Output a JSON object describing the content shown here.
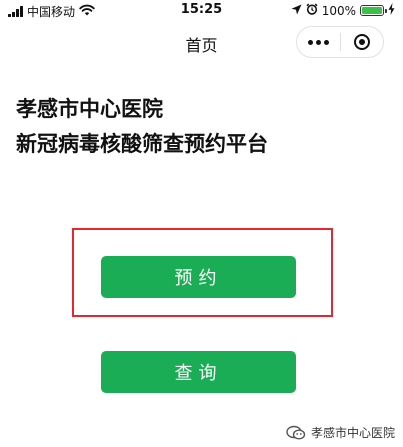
{
  "status_bar": {
    "carrier": "中国移动",
    "time": "15:25",
    "battery_percent": "100%",
    "battery_level": 1.0,
    "icons": [
      "signal-icon",
      "wifi-icon",
      "location-icon",
      "alarm-icon",
      "battery-icon",
      "charging-icon"
    ]
  },
  "nav": {
    "title": "首页",
    "more_icon": "more-dots-icon",
    "close_icon": "miniprogram-close-icon"
  },
  "headline": {
    "line1": "孝感市中心医院",
    "line2": "新冠病毒核酸筛查预约平台"
  },
  "buttons": {
    "book": "预约",
    "query": "查询"
  },
  "colors": {
    "button_green": "#1aad55",
    "highlight_red": "#e8262d",
    "battery_green": "#3bc14a"
  },
  "watermark": {
    "text": "孝感市中心医院",
    "icon": "wechat-official-account-icon"
  }
}
